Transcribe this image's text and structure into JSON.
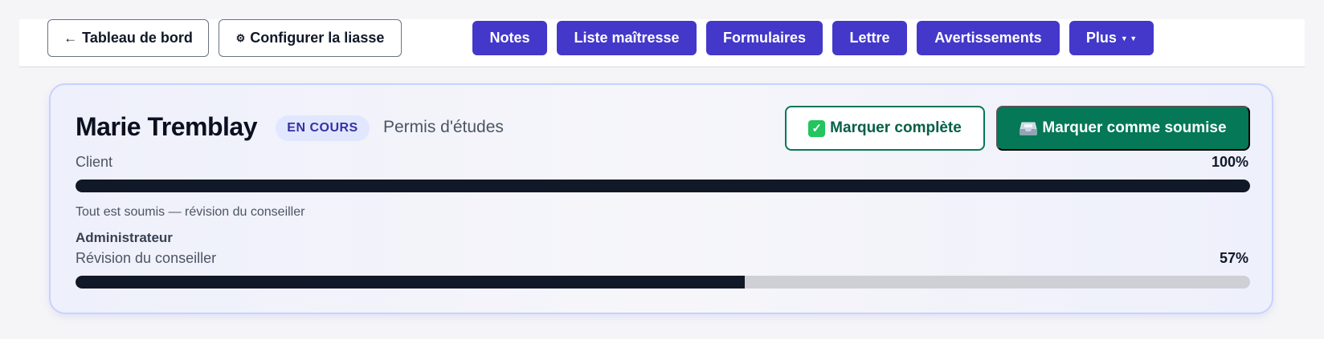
{
  "toolbar": {
    "dashboard_label": "Tableau de bord",
    "configure_label": "Configurer la liasse",
    "nav": [
      {
        "label": "Notes"
      },
      {
        "label": "Liste maîtresse"
      },
      {
        "label": "Formulaires"
      },
      {
        "label": "Lettre"
      },
      {
        "label": "Avertissements"
      },
      {
        "label": "Plus"
      }
    ]
  },
  "file": {
    "client_name": "Marie Tremblay",
    "status": "EN COURS",
    "program": "Permis d'études",
    "complete_label": "Marquer complète",
    "submit_label": "Marquer comme soumise"
  },
  "progress": {
    "client": {
      "label": "Client",
      "percent_text": "100%",
      "value": 100,
      "note": "Tout est soumis — révision du conseiller"
    },
    "admin_section": "Administrateur",
    "review": {
      "label": "Révision du conseiller",
      "percent_text": "57%",
      "value": 57
    }
  },
  "colors": {
    "nav_bg": "#4338ca",
    "success": "#047857",
    "bar_fill": "#111827",
    "bar_track": "#cfd0d6",
    "badge_bg": "#e0e7ff"
  },
  "icons": {
    "back": "arrow-left-icon",
    "configure": "gear-icon",
    "complete": "check-box-icon",
    "submit": "inbox-tray-icon",
    "dropdown": "caret-down-icon"
  }
}
